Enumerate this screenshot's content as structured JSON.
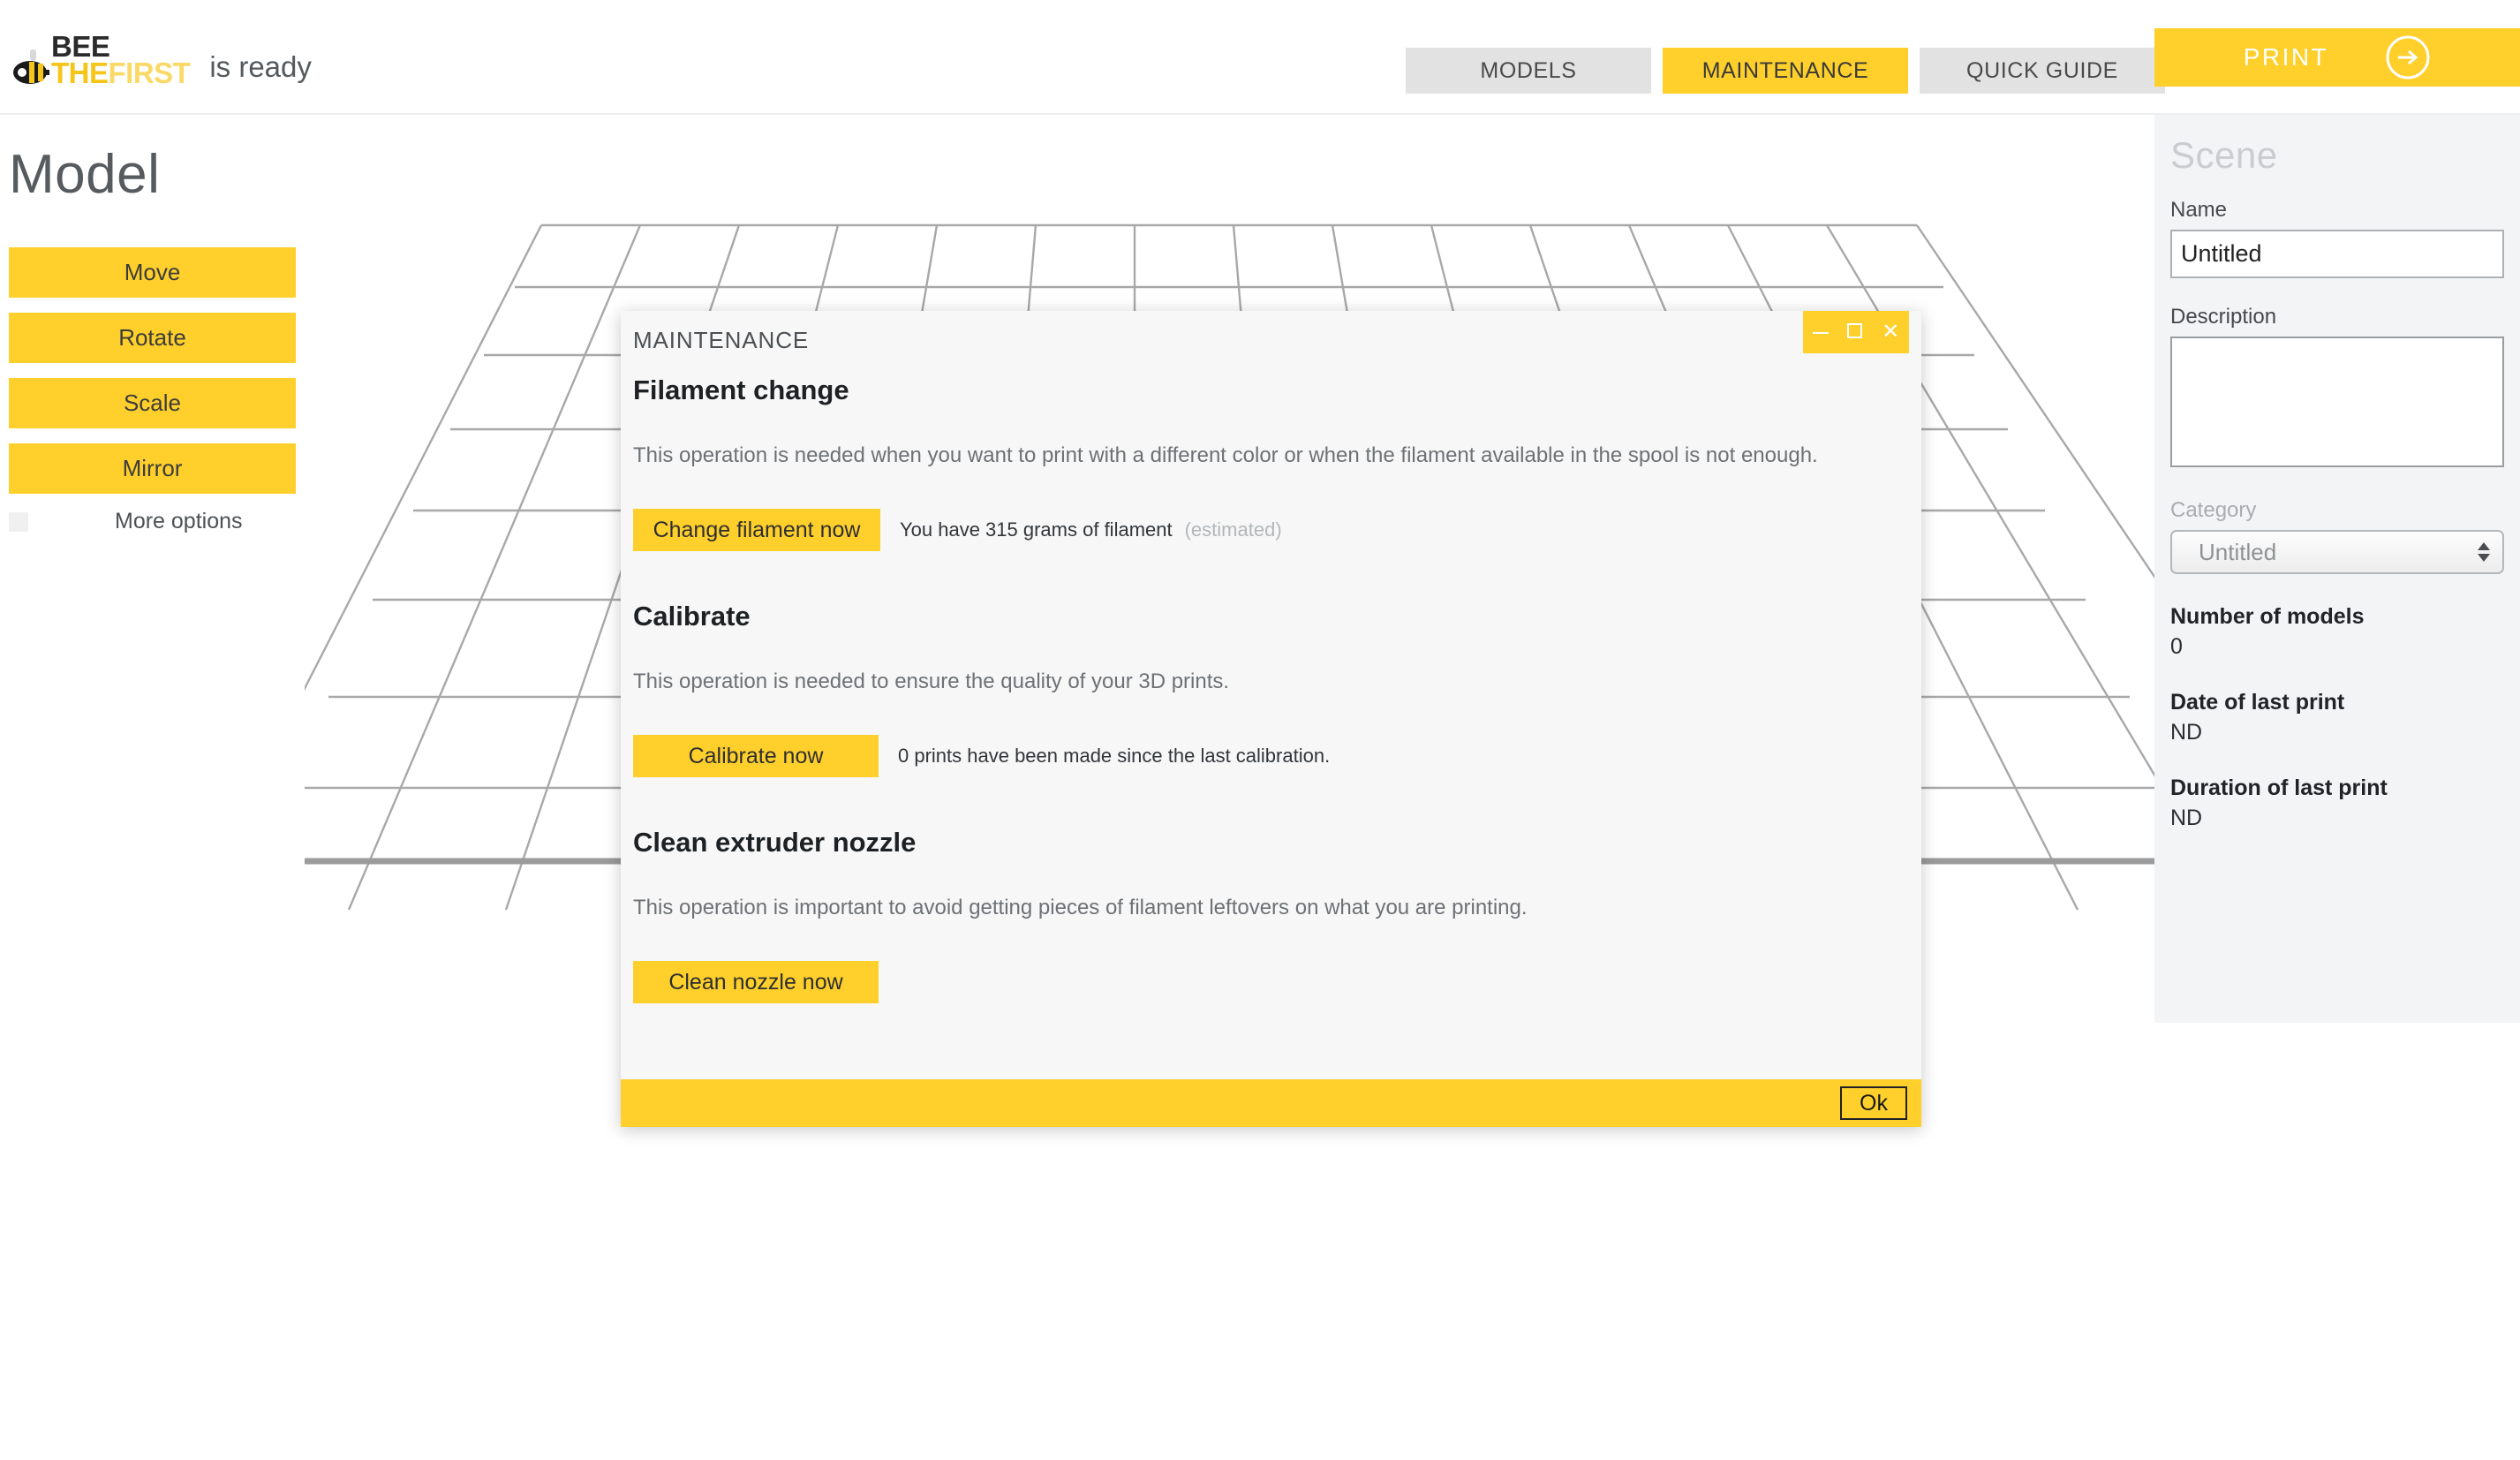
{
  "header": {
    "logo": {
      "line1": "BEE",
      "the": "THE",
      "first": "FIRST",
      "icon": "bee-icon"
    },
    "status_text": "is ready",
    "tabs": [
      {
        "label": "MODELS",
        "active": false
      },
      {
        "label": "MAINTENANCE",
        "active": true
      },
      {
        "label": "QUICK GUIDE",
        "active": false
      }
    ],
    "print_button": {
      "label": "PRINT",
      "icon": "arrow-right-circle-icon"
    }
  },
  "left_panel": {
    "title": "Model",
    "buttons": [
      "Move",
      "Rotate",
      "Scale",
      "Mirror"
    ],
    "more_options_label": "More options"
  },
  "right_panel": {
    "title": "Scene",
    "name_label": "Name",
    "name_value": "Untitled",
    "description_label": "Description",
    "description_value": "",
    "category_label": "Category",
    "category_value": "Untitled",
    "stats": [
      {
        "title": "Number of models",
        "value": "0"
      },
      {
        "title": "Date of last print",
        "value": "ND"
      },
      {
        "title": "Duration of last print",
        "value": "ND"
      }
    ]
  },
  "modal": {
    "title": "MAINTENANCE",
    "window_controls": {
      "minimize": "–",
      "maximize": "□",
      "close": "✕"
    },
    "sections": [
      {
        "heading": "Filament change",
        "description": "This operation is needed when you want to print with a different color or when the filament available in the spool is not enough.",
        "button": "Change filament now",
        "note": "You have 315 grams of filament",
        "note_dim": "(estimated)"
      },
      {
        "heading": "Calibrate",
        "description": "This operation is needed to ensure the quality of your 3D prints.",
        "button": "Calibrate now",
        "note": "0 prints have been made since the last calibration.",
        "note_dim": ""
      },
      {
        "heading": "Clean extruder nozzle",
        "description": "This operation is important to avoid getting pieces of filament leftovers on what you are printing.",
        "button": "Clean nozzle now",
        "note": "",
        "note_dim": ""
      }
    ],
    "ok_label": "Ok"
  },
  "colors": {
    "accent_yellow": "#ffcf2b",
    "logo_the": "#f5c518",
    "logo_first": "#fbd967",
    "panel_gray": "#f2f4f5",
    "tab_gray": "#e2e2e2"
  }
}
